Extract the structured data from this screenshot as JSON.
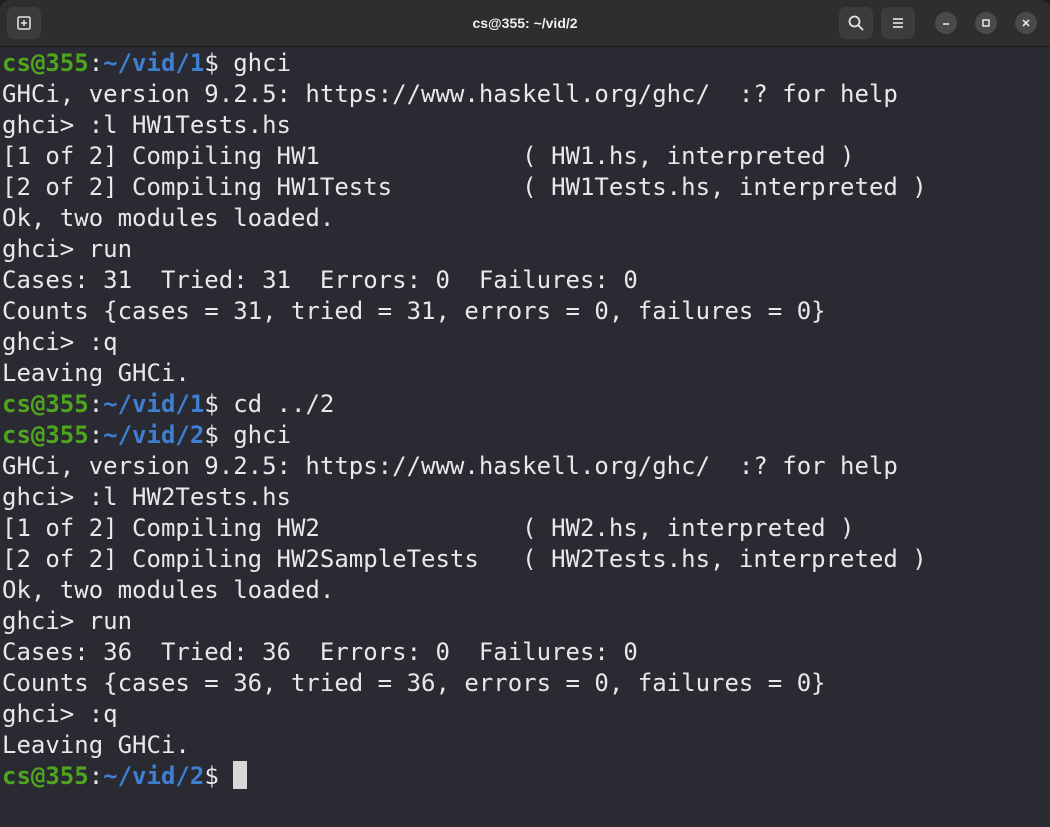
{
  "window": {
    "title": "cs@355: ~/vid/2"
  },
  "icons": {
    "new_tab": "new-tab-icon",
    "search": "search-icon",
    "menu": "hamburger-menu-icon",
    "minimize": "minimize-icon",
    "maximize": "maximize-icon",
    "close": "close-icon"
  },
  "colors": {
    "prompt_user": "#4fa51e",
    "prompt_path": "#3f7fd2",
    "text": "#e8e8e8",
    "background": "#2a2a33"
  },
  "terminal": {
    "lines": [
      {
        "type": "prompt",
        "user": "cs@355",
        "sep": ":",
        "path": "~/vid/1",
        "sigil": "$ ",
        "cmd": "ghci"
      },
      {
        "type": "text",
        "text": "GHCi, version 9.2.5: https://www.haskell.org/ghc/  :? for help"
      },
      {
        "type": "text",
        "text": "ghci> :l HW1Tests.hs"
      },
      {
        "type": "text",
        "text": "[1 of 2] Compiling HW1              ( HW1.hs, interpreted )"
      },
      {
        "type": "text",
        "text": "[2 of 2] Compiling HW1Tests         ( HW1Tests.hs, interpreted )"
      },
      {
        "type": "text",
        "text": "Ok, two modules loaded."
      },
      {
        "type": "text",
        "text": "ghci> run"
      },
      {
        "type": "text",
        "text": "Cases: 31  Tried: 31  Errors: 0  Failures: 0"
      },
      {
        "type": "text",
        "text": "Counts {cases = 31, tried = 31, errors = 0, failures = 0}"
      },
      {
        "type": "text",
        "text": "ghci> :q"
      },
      {
        "type": "text",
        "text": "Leaving GHCi."
      },
      {
        "type": "prompt",
        "user": "cs@355",
        "sep": ":",
        "path": "~/vid/1",
        "sigil": "$ ",
        "cmd": "cd ../2"
      },
      {
        "type": "prompt",
        "user": "cs@355",
        "sep": ":",
        "path": "~/vid/2",
        "sigil": "$ ",
        "cmd": "ghci"
      },
      {
        "type": "text",
        "text": "GHCi, version 9.2.5: https://www.haskell.org/ghc/  :? for help"
      },
      {
        "type": "text",
        "text": "ghci> :l HW2Tests.hs"
      },
      {
        "type": "text",
        "text": "[1 of 2] Compiling HW2              ( HW2.hs, interpreted )"
      },
      {
        "type": "text",
        "text": "[2 of 2] Compiling HW2SampleTests   ( HW2Tests.hs, interpreted )"
      },
      {
        "type": "text",
        "text": "Ok, two modules loaded."
      },
      {
        "type": "text",
        "text": "ghci> run"
      },
      {
        "type": "text",
        "text": "Cases: 36  Tried: 36  Errors: 0  Failures: 0"
      },
      {
        "type": "text",
        "text": "Counts {cases = 36, tried = 36, errors = 0, failures = 0}"
      },
      {
        "type": "text",
        "text": "ghci> :q"
      },
      {
        "type": "text",
        "text": "Leaving GHCi."
      },
      {
        "type": "prompt",
        "user": "cs@355",
        "sep": ":",
        "path": "~/vid/2",
        "sigil": "$ ",
        "cmd": ""
      }
    ]
  }
}
